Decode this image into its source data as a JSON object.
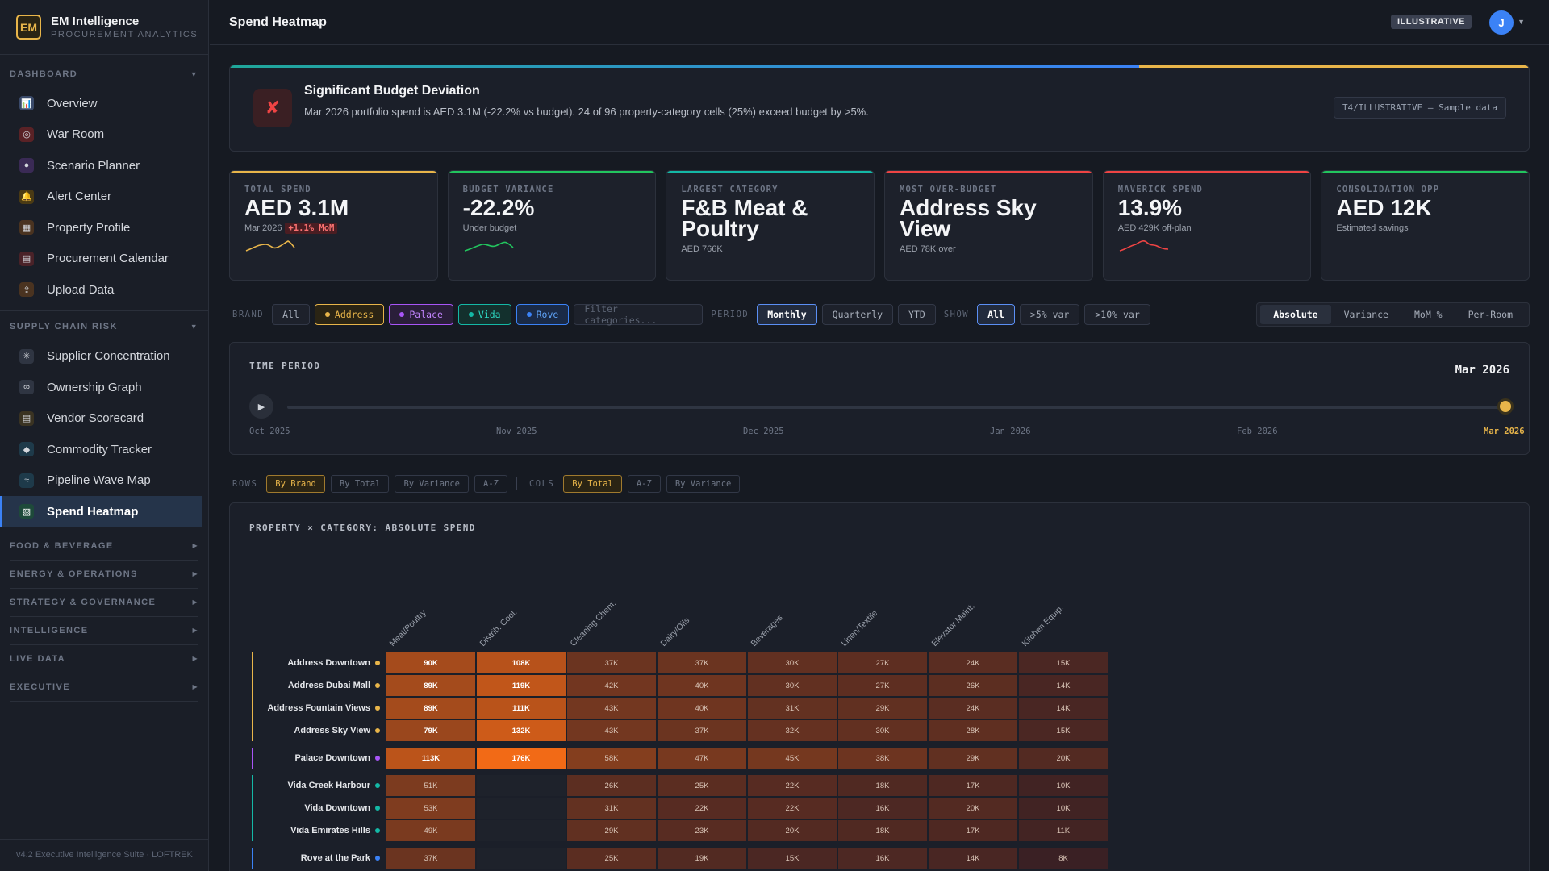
{
  "brand": {
    "logo": "EM",
    "name": "EM Intelligence",
    "sub": "PROCUREMENT ANALYTICS"
  },
  "sidebar": {
    "dashboard_label": "DASHBOARD",
    "dashboard_items": [
      {
        "label": "Overview",
        "icon": "bar-chart-icon"
      },
      {
        "label": "War Room",
        "icon": "target-icon"
      },
      {
        "label": "Scenario Planner",
        "icon": "crystal-ball-icon"
      },
      {
        "label": "Alert Center",
        "icon": "bell-icon"
      },
      {
        "label": "Property Profile",
        "icon": "building-icon"
      },
      {
        "label": "Procurement Calendar",
        "icon": "calendar-icon"
      },
      {
        "label": "Upload Data",
        "icon": "upload-icon"
      }
    ],
    "supply_label": "SUPPLY CHAIN RISK",
    "supply_items": [
      {
        "label": "Supplier Concentration",
        "icon": "network-icon"
      },
      {
        "label": "Ownership Graph",
        "icon": "link-icon"
      },
      {
        "label": "Vendor Scorecard",
        "icon": "clipboard-icon"
      },
      {
        "label": "Commodity Tracker",
        "icon": "gem-icon"
      },
      {
        "label": "Pipeline Wave Map",
        "icon": "wave-icon"
      },
      {
        "label": "Spend Heatmap",
        "icon": "map-icon"
      }
    ],
    "collapsed": [
      "FOOD & BEVERAGE",
      "ENERGY & OPERATIONS",
      "STRATEGY & GOVERNANCE",
      "INTELLIGENCE",
      "LIVE DATA",
      "EXECUTIVE"
    ],
    "footer": "v4.2 Executive Intelligence Suite · LOFTREK"
  },
  "topbar": {
    "title": "Spend Heatmap",
    "badge": "ILLUSTRATIVE",
    "avatar": "J"
  },
  "alert": {
    "title": "Significant Budget Deviation",
    "body": "Mar 2026 portfolio spend is AED 3.1M (-22.2% vs budget). 24 of 96 property-category cells (25%) exceed budget by >5%.",
    "tag": "T4/ILLUSTRATIVE — Sample data"
  },
  "kpis": [
    {
      "label": "TOTAL SPEND",
      "value": "AED 3.1M",
      "sub": "Mar 2026",
      "mom": "+1.1% MoM",
      "color": "#e8b54a",
      "spark": "#e8b54a"
    },
    {
      "label": "BUDGET VARIANCE",
      "value": "-22.2%",
      "sub": "Under budget",
      "color": "#22c55e",
      "spark": "#22c55e"
    },
    {
      "label": "LARGEST CATEGORY",
      "value": "F&B Meat & Poultry",
      "sub": "AED 766K",
      "color": "#14b8a6"
    },
    {
      "label": "MOST OVER-BUDGET",
      "value": "Address Sky View",
      "sub": "AED 78K over",
      "color": "#ef4444"
    },
    {
      "label": "MAVERICK SPEND",
      "value": "13.9%",
      "sub": "AED 429K off-plan",
      "color": "#ef4444",
      "spark": "#ef4444"
    },
    {
      "label": "CONSOLIDATION OPP",
      "value": "AED 12K",
      "sub": "Estimated savings",
      "color": "#22c55e"
    }
  ],
  "filters": {
    "brand_label": "BRAND",
    "brands": [
      "All",
      "Address",
      "Palace",
      "Vida",
      "Rove"
    ],
    "filter_placeholder": "Filter categories...",
    "period_label": "PERIOD",
    "periods": [
      "Monthly",
      "Quarterly",
      "YTD"
    ],
    "show_label": "SHOW",
    "shows": [
      "All",
      ">5% var",
      ">10% var"
    ],
    "views": [
      "Absolute",
      "Variance",
      "MoM %",
      "Per-Room"
    ]
  },
  "timeline": {
    "label": "TIME PERIOD",
    "current": "Mar 2026",
    "ticks": [
      "Oct 2025",
      "Nov 2025",
      "Dec 2025",
      "Jan 2026",
      "Feb 2026",
      "Mar 2026"
    ],
    "position": 1.0
  },
  "sort": {
    "rows_label": "ROWS",
    "rows": [
      "By Brand",
      "By Total",
      "By Variance",
      "A-Z"
    ],
    "cols_label": "COLS",
    "cols": [
      "By Total",
      "A-Z",
      "By Variance"
    ]
  },
  "heatmap": {
    "label": "PROPERTY × CATEGORY: ABSOLUTE SPEND",
    "columns": [
      "Meat/Poultry",
      "Distrib. Cool.",
      "Cleaning Chem.",
      "Dairy/Oils",
      "Beverages",
      "Linen/Textile",
      "Elevator Maint.",
      "Kitchen Equip."
    ],
    "rows": [
      {
        "name": "Address Downtown",
        "brand": "address",
        "values": [
          "90K",
          "108K",
          "37K",
          "37K",
          "30K",
          "27K",
          "24K",
          "15K"
        ]
      },
      {
        "name": "Address Dubai Mall",
        "brand": "address",
        "values": [
          "89K",
          "119K",
          "42K",
          "40K",
          "30K",
          "27K",
          "26K",
          "14K"
        ]
      },
      {
        "name": "Address Fountain Views",
        "brand": "address",
        "values": [
          "89K",
          "111K",
          "43K",
          "40K",
          "31K",
          "29K",
          "24K",
          "14K"
        ]
      },
      {
        "name": "Address Sky View",
        "brand": "address",
        "values": [
          "79K",
          "132K",
          "43K",
          "37K",
          "32K",
          "30K",
          "28K",
          "15K"
        ]
      },
      {
        "name": "Palace Downtown",
        "brand": "palace",
        "values": [
          "113K",
          "176K",
          "58K",
          "47K",
          "45K",
          "38K",
          "29K",
          "20K"
        ]
      },
      {
        "name": "Vida Creek Harbour",
        "brand": "vida",
        "values": [
          "51K",
          "",
          "26K",
          "25K",
          "22K",
          "18K",
          "17K",
          "10K"
        ]
      },
      {
        "name": "Vida Downtown",
        "brand": "vida",
        "values": [
          "53K",
          "",
          "31K",
          "22K",
          "22K",
          "16K",
          "20K",
          "10K"
        ]
      },
      {
        "name": "Vida Emirates Hills",
        "brand": "vida",
        "values": [
          "49K",
          "",
          "29K",
          "23K",
          "20K",
          "18K",
          "17K",
          "11K"
        ]
      },
      {
        "name": "Rove at the Park",
        "brand": "rove",
        "values": [
          "37K",
          "",
          "25K",
          "19K",
          "15K",
          "16K",
          "14K",
          "8K"
        ]
      }
    ],
    "brand_colors": {
      "address": "#e8b54a",
      "palace": "#a855f7",
      "vida": "#14b8a6",
      "rove": "#3b82f6"
    }
  }
}
